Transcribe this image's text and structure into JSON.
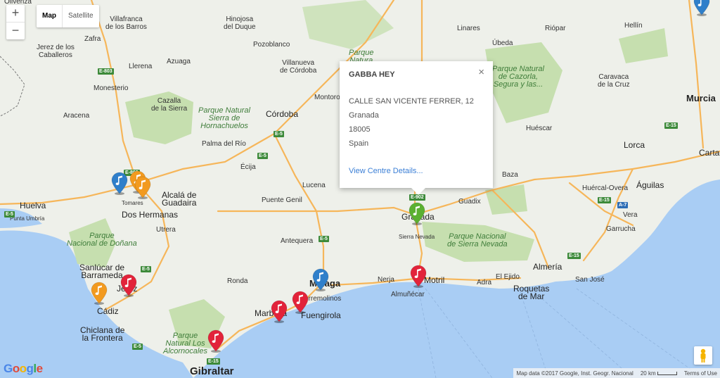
{
  "controls": {
    "zoom_in": "+",
    "zoom_out": "−",
    "map_label": "Map",
    "satellite_label": "Satellite"
  },
  "infowindow": {
    "title": "GABBA HEY",
    "close": "×",
    "address_lines": [
      "CALLE SAN VICENTE FERRER, 12",
      "Granada",
      "18005",
      "Spain"
    ],
    "link_label": "View Centre Details..."
  },
  "places": [
    {
      "label": "Villafranca\nde los Barros"
    },
    {
      "label": "Hinojosa\ndel Duque"
    },
    {
      "label": "Zafra"
    },
    {
      "label": "Jerez de los\nCaballeros"
    },
    {
      "label": "Pozoblanco"
    },
    {
      "label": "Villanueva\nde Córdoba"
    },
    {
      "label": "Azuaga"
    },
    {
      "label": "Llerena"
    },
    {
      "label": "Monesterio"
    },
    {
      "label": "Aracena"
    },
    {
      "label": "Cazalla\nde la Sierra"
    },
    {
      "label": "Montoro"
    },
    {
      "label": "Córdoba"
    },
    {
      "label": "Palma del Río"
    },
    {
      "label": "Écija"
    },
    {
      "label": "Alcalá de\nGuadaira"
    },
    {
      "label": "Dos Hermanas"
    },
    {
      "label": "Utrera"
    },
    {
      "label": "Tomares"
    },
    {
      "label": "Huelva"
    },
    {
      "label": "Punta Umbría"
    },
    {
      "label": "Lucena"
    },
    {
      "label": "Puente Genil"
    },
    {
      "label": "Antequera"
    },
    {
      "label": "Ronda"
    },
    {
      "label": "Sanlúcar de\nBarrameda"
    },
    {
      "label": "Jerez"
    },
    {
      "label": "Cádiz"
    },
    {
      "label": "Chiclana de\nla Frontera"
    },
    {
      "label": "Marbella"
    },
    {
      "label": "Fuengirola"
    },
    {
      "label": "Torremolinos"
    },
    {
      "label": "Málaga"
    },
    {
      "label": "Gibraltar"
    },
    {
      "label": "Nerja"
    },
    {
      "label": "Almuñécar"
    },
    {
      "label": "Motril"
    },
    {
      "label": "Adra"
    },
    {
      "label": "El Ejido"
    },
    {
      "label": "Roquetas\nde Mar"
    },
    {
      "label": "Almería"
    },
    {
      "label": "San José"
    },
    {
      "label": "Granada"
    },
    {
      "label": "Sierra Nevada"
    },
    {
      "label": "Guadix"
    },
    {
      "label": "Baza"
    },
    {
      "label": "Huéscar"
    },
    {
      "label": "Lorca"
    },
    {
      "label": "Huércal-Overa"
    },
    {
      "label": "Águilas"
    },
    {
      "label": "Vera"
    },
    {
      "label": "Garrucha"
    },
    {
      "label": "Caravaca\nde la Cruz"
    },
    {
      "label": "Murcia"
    },
    {
      "label": "Cartag"
    },
    {
      "label": "Hellín"
    },
    {
      "label": "Riópar"
    },
    {
      "label": "Úbeda"
    },
    {
      "label": "Linares"
    },
    {
      "label": "Olivenza"
    }
  ],
  "parks": [
    {
      "label": "Parque Natural\nSierra de\nHornachuelos"
    },
    {
      "label": "Parque\nNacional de Doñana"
    },
    {
      "label": "Parque\nNatural Los\nAlcornocales"
    },
    {
      "label": "Parque Nacional\nde Sierra Nevada"
    },
    {
      "label": "Parque Natural\nde Cazorla,\nSegura y las..."
    },
    {
      "label": "Parque\nNatura"
    }
  ],
  "road_shields": [
    "E-803",
    "E-5",
    "E-803",
    "E-5",
    "E-5",
    "E-5",
    "E-15",
    "E-902",
    "E-15",
    "A-7",
    "E-15",
    "E-15",
    "E-5",
    "E-5"
  ],
  "markers": [
    {
      "color": "#2f7fca",
      "category": "music-note-icon"
    },
    {
      "color": "#f29a1f",
      "category": "music-note-icon"
    },
    {
      "color": "#f29a1f",
      "category": "music-note-icon"
    },
    {
      "color": "#f29a1f",
      "category": "music-note-icon"
    },
    {
      "color": "#e2233a",
      "category": "music-note-icon"
    },
    {
      "color": "#2f7fca",
      "category": "music-note-icon"
    },
    {
      "color": "#e2233a",
      "category": "music-note-icon"
    },
    {
      "color": "#e2233a",
      "category": "music-note-icon"
    },
    {
      "color": "#e2233a",
      "category": "music-note-icon"
    },
    {
      "color": "#e2233a",
      "category": "music-note-icon"
    },
    {
      "color": "#5bb031",
      "category": "music-note-icon"
    },
    {
      "color": "#2f7fca",
      "category": "music-note-icon"
    }
  ],
  "attribution": {
    "data": "Map data ©2017 Google, Inst. Geogr. Nacional",
    "scale": "20 km",
    "terms": "Terms of Use"
  },
  "logo": "Google",
  "colors": {
    "sea": "#a9cdf4",
    "land": "#eef0ea",
    "park": "#c6dfaf",
    "highway": "#f6b65a",
    "road": "#ffffff"
  }
}
